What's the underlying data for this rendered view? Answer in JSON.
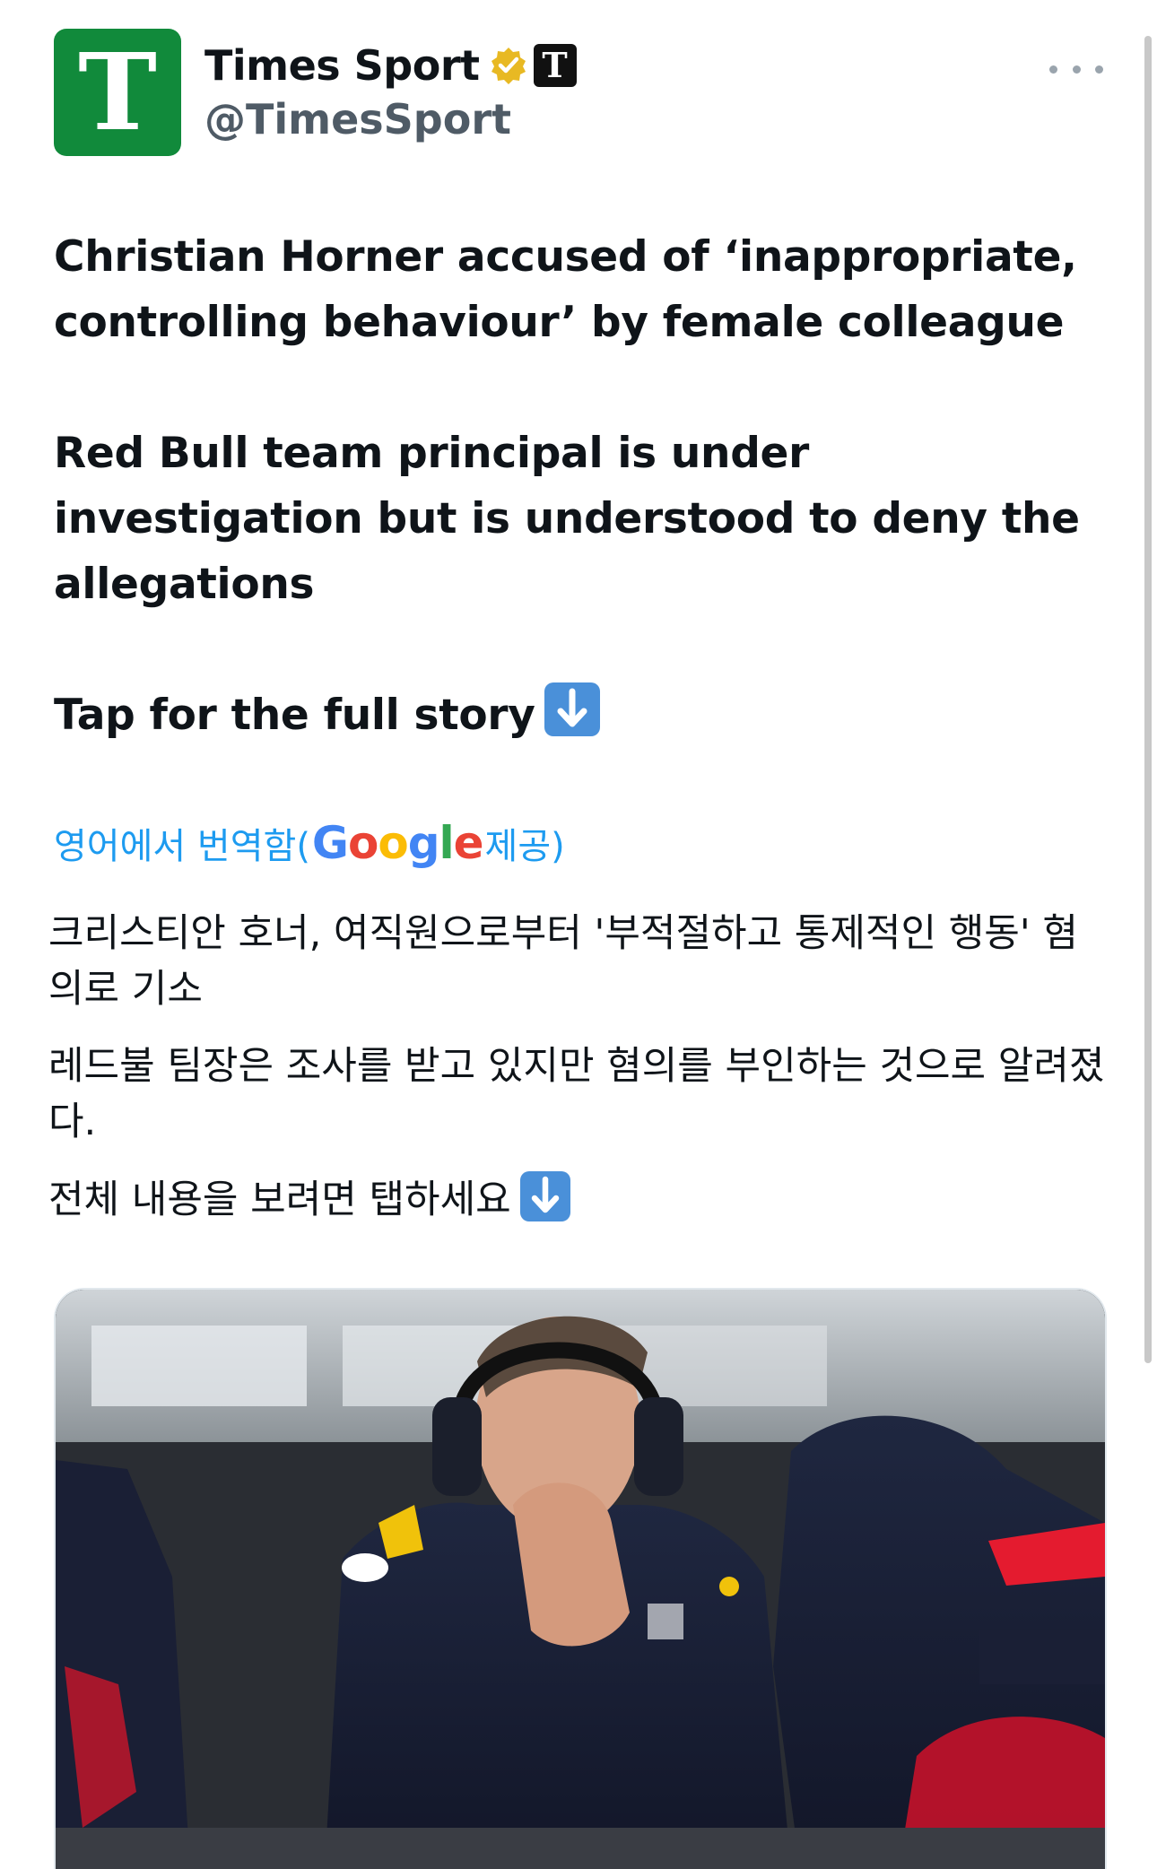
{
  "account": {
    "display_name": "Times Sport",
    "handle": "@TimesSport",
    "avatar_letter": "T",
    "affiliate_letter": "T",
    "avatar_color": "#118a3b",
    "verified_color": "#e8b923"
  },
  "tweet": {
    "headline": "Christian Horner accused of ‘inappropriate, controlling behaviour’ by female colleague",
    "standfirst": "Red Bull team principal is under investigation but is understood to deny the allegations",
    "cta": "Tap for the full story"
  },
  "translation": {
    "label_prefix": "영어에서 번역함(",
    "label_suffix": " 제공)",
    "google_letters": [
      "G",
      "o",
      "o",
      "g",
      "l",
      "e"
    ],
    "headline": "크리스티안 호너, 여직원으로부터 '부적절하고 통제적인 행동' 혐의로 기소",
    "standfirst": "레드불 팀장은 조사를 받고 있지만 혐의를 부인하는 것으로 알려졌다.",
    "cta": "전체 내용을 보려면 탭하세요"
  },
  "icons": {
    "more": "more-horizontal-icon",
    "verified": "verified-badge-icon",
    "arrow": "down-arrow-emoji-icon"
  },
  "colors": {
    "link": "#1d9bf0",
    "text": "#0f1419",
    "handle": "#4f5b66"
  }
}
